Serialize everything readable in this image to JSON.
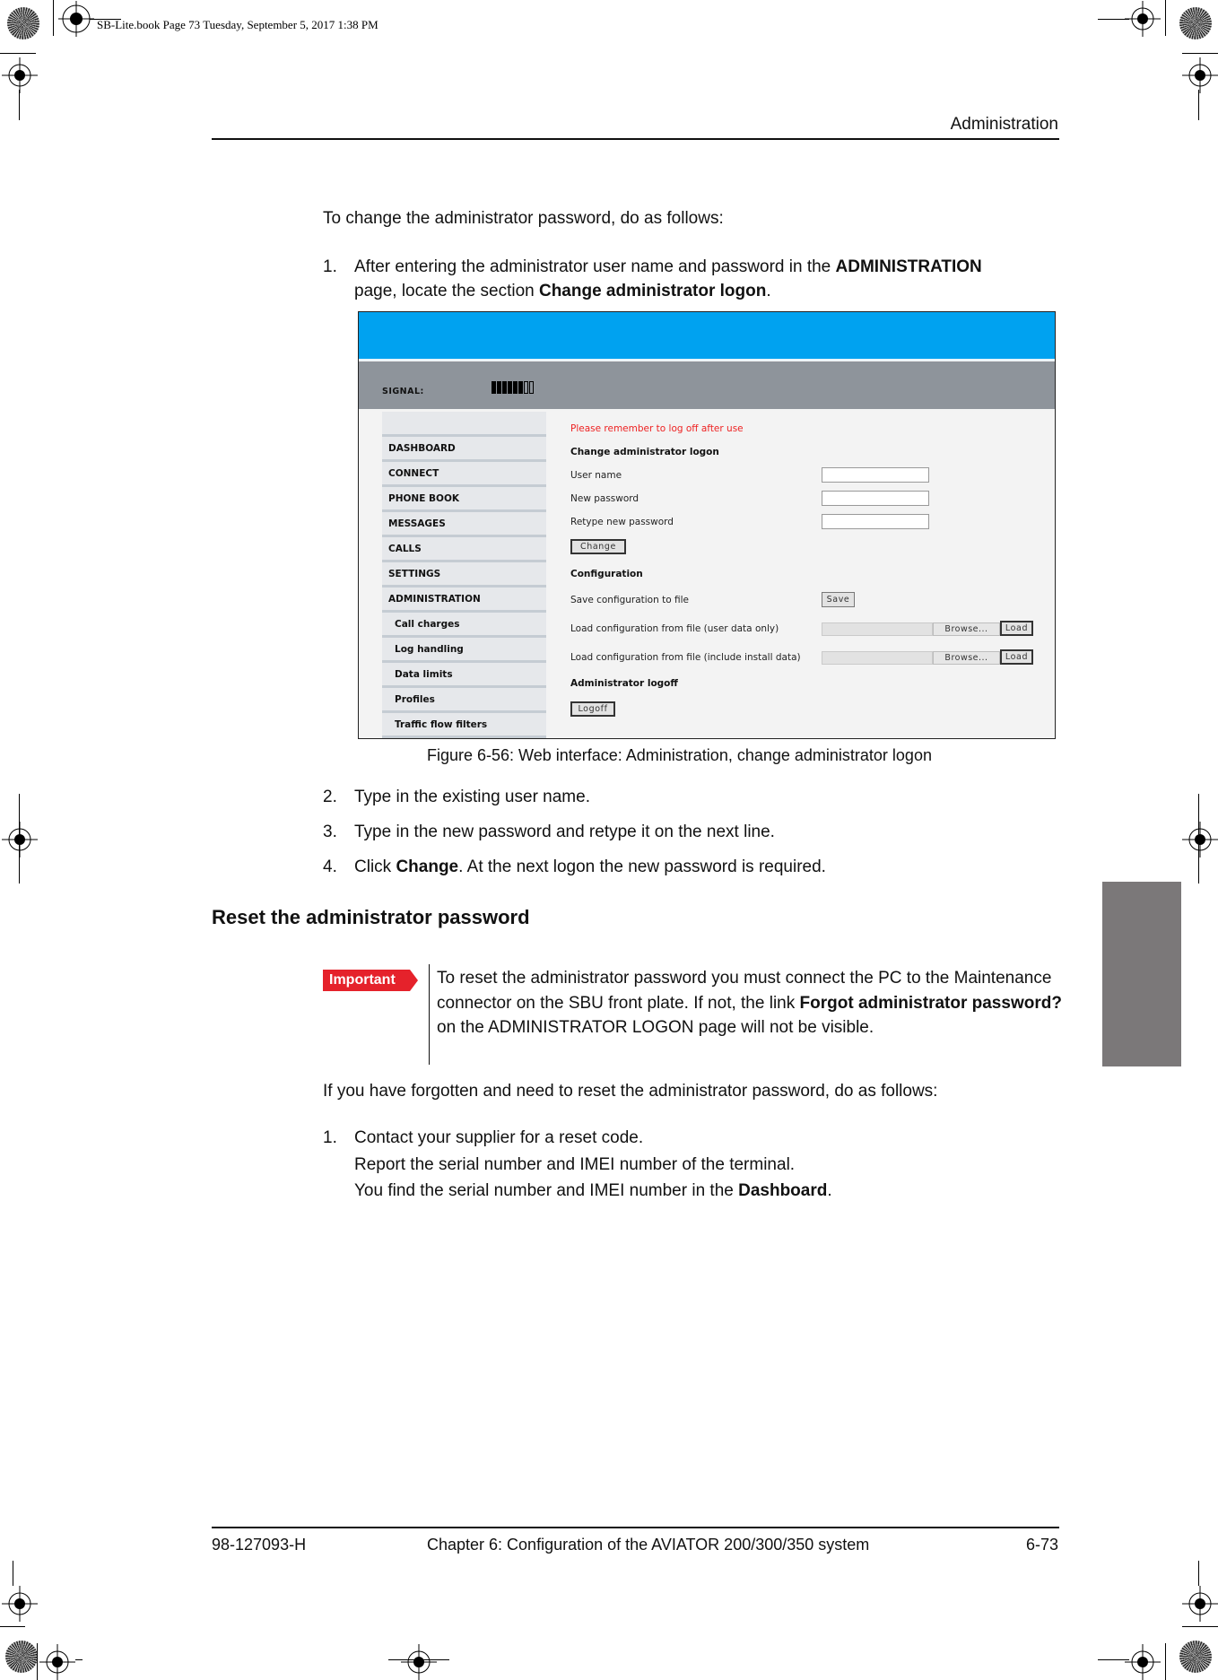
{
  "print_slug": "SB-Lite.book  Page 73  Tuesday, September 5, 2017  1:38 PM",
  "running_header": "Administration",
  "intro": "To change the administrator password, do as follows:",
  "steps_change": [
    {
      "num": "1.",
      "parts": [
        "After entering the administrator user name and password in the ",
        "ADMINISTRATION",
        "page, locate the section ",
        "Change administrator logon",
        "."
      ]
    },
    {
      "num": "2.",
      "text": "Type in the existing user name."
    },
    {
      "num": "3.",
      "text": "Type in the new password and retype it on the next line."
    },
    {
      "num": "4.",
      "parts": [
        "Click ",
        "Change",
        ". At the next logon the new password is required."
      ]
    }
  ],
  "figure": {
    "signal_label": "SIGNAL:",
    "signal_level": {
      "filled": 6,
      "total": 8
    },
    "colors": {
      "header_blue": "#00a2f0",
      "status_gray": "#8e949b",
      "warning_red": "#ee2222"
    },
    "sidebar": [
      {
        "label": "DASHBOARD",
        "sub": false
      },
      {
        "label": "CONNECT",
        "sub": false
      },
      {
        "label": "PHONE BOOK",
        "sub": false
      },
      {
        "label": "MESSAGES",
        "sub": false
      },
      {
        "label": "CALLS",
        "sub": false
      },
      {
        "label": "SETTINGS",
        "sub": false
      },
      {
        "label": "ADMINISTRATION",
        "sub": false
      },
      {
        "label": "Call charges",
        "sub": true
      },
      {
        "label": "Log handling",
        "sub": true
      },
      {
        "label": "Data limits",
        "sub": true
      },
      {
        "label": "Profiles",
        "sub": true
      },
      {
        "label": "Traffic flow filters",
        "sub": true
      }
    ],
    "warning": "Please remember to log off after use",
    "change_logon": {
      "heading": "Change administrator logon",
      "user_name_label": "User name",
      "user_name_value": "",
      "new_password_label": "New password",
      "new_password_value": "",
      "retype_label": "Retype new password",
      "retype_value": "",
      "change_button": "Change"
    },
    "configuration": {
      "heading": "Configuration",
      "save_label": "Save configuration to file",
      "save_button": "Save",
      "load_user_label": "Load configuration from file (user data only)",
      "load_install_label": "Load configuration from file (include install data)",
      "browse_button": "Browse...",
      "load_button": "Load"
    },
    "logoff": {
      "heading": "Administrator logoff",
      "button": "Logoff"
    },
    "caption": "Figure 6-56: Web interface: Administration, change administrator logon"
  },
  "section_heading": "Reset the administrator password",
  "important": {
    "badge": "Important",
    "parts": [
      "To reset the administrator password you must connect the PC to the Maintenance connector on the SBU front plate. If not, the link ",
      "Forgot administrator password?",
      " on the ADMINISTRATOR LOGON page will not be visible."
    ]
  },
  "reset_intro": "If you have forgotten and need to reset the administrator password, do as follows:",
  "steps_reset": [
    {
      "num": "1.",
      "text": "Contact your supplier for a reset code.",
      "line2": "Report the serial number and IMEI number of the terminal.",
      "line3_parts": [
        "You find the serial number and IMEI number in the ",
        "Dashboard",
        "."
      ]
    }
  ],
  "footer": {
    "doc_number": "98-127093-H",
    "chapter": "Chapter 6:  Configuration of the AVIATOR 200/300/350 system",
    "page": "6-73"
  }
}
